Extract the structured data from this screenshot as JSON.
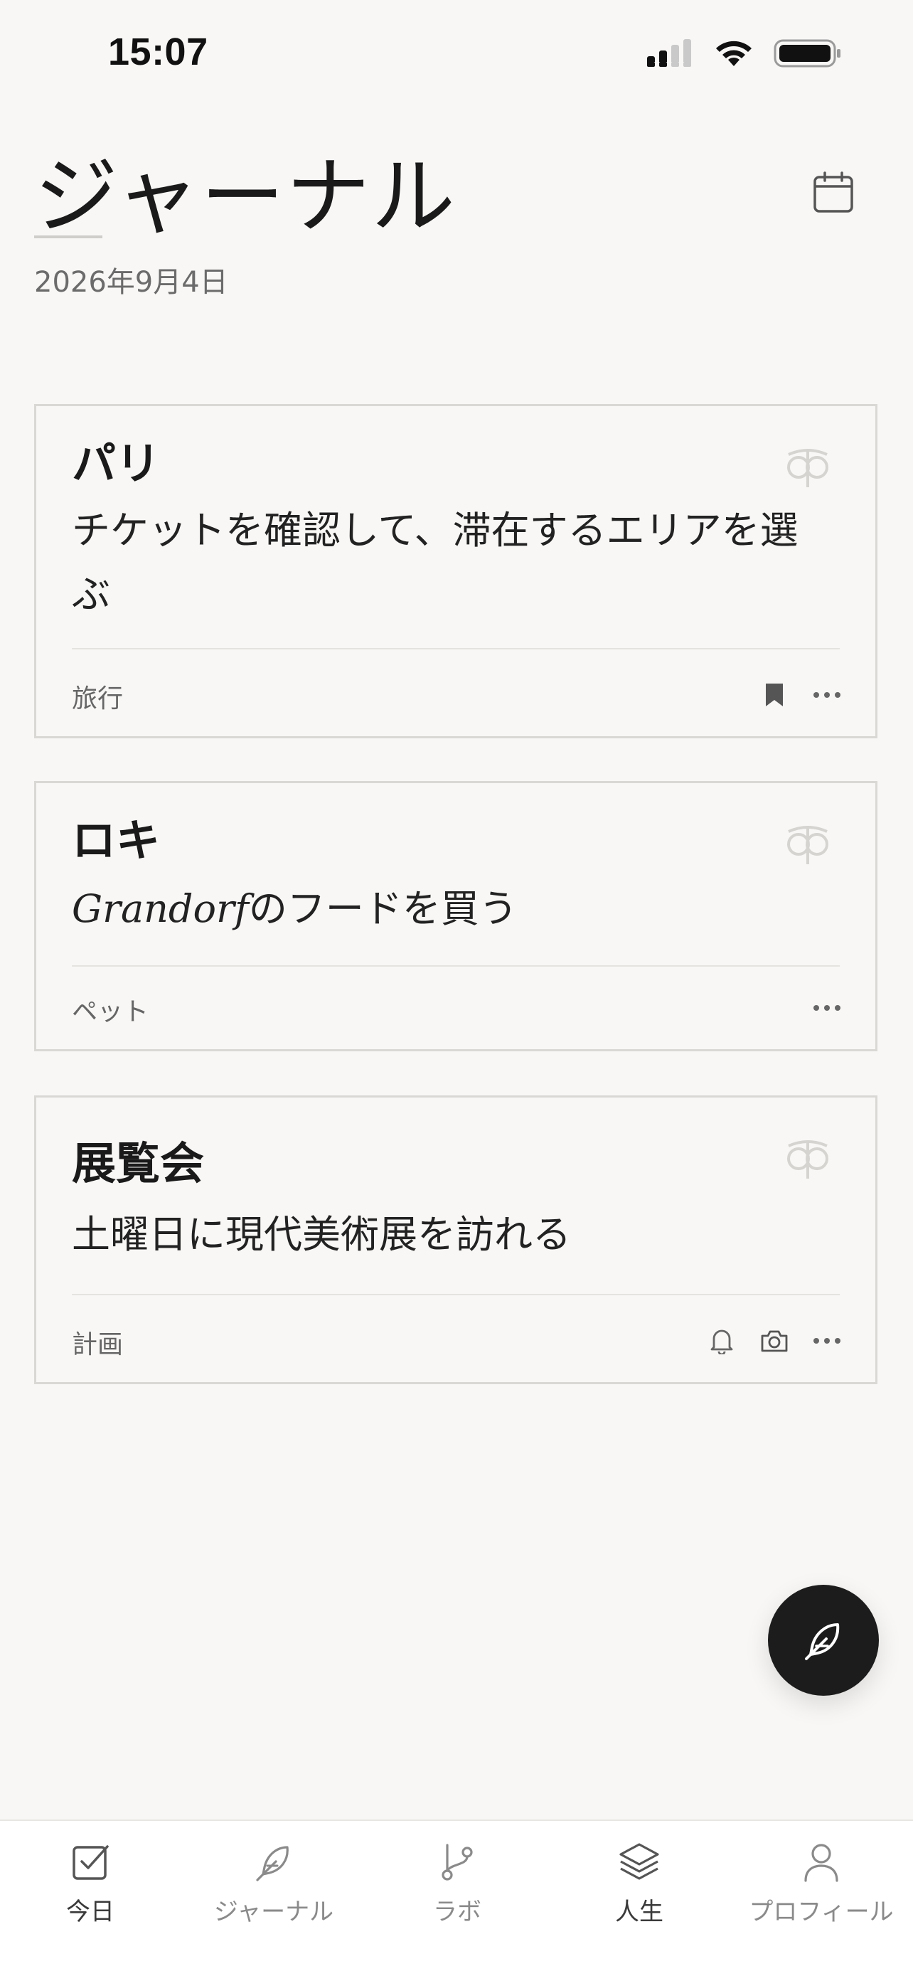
{
  "status_bar": {
    "time": "15:07",
    "icons": [
      "cellular-signal-icon",
      "wifi-icon",
      "battery-icon"
    ]
  },
  "header": {
    "title": "ジャーナル",
    "date": "2026年9月4日",
    "calendar_icon": "calendar-icon"
  },
  "cards": [
    {
      "title": "パリ",
      "body": "チケットを確認して、滞在するエリアを選ぶ",
      "tag": "旅行",
      "actions": [
        "bookmark-icon",
        "more-icon"
      ]
    },
    {
      "title": "ロキ",
      "body_italic": "Grandorf",
      "body_rest": "のフードを買う",
      "tag": "ペット",
      "actions": [
        "more-icon"
      ]
    },
    {
      "title": "展覧会",
      "body": "土曜日に現代美術展を訪れる",
      "tag": "計画",
      "actions": [
        "bell-icon",
        "camera-icon",
        "more-icon"
      ]
    }
  ],
  "fab": {
    "icon": "feather-pen-icon"
  },
  "tab_bar": {
    "tabs": [
      {
        "label": "今日",
        "icon": "checkbox-icon",
        "active": true
      },
      {
        "label": "ジャーナル",
        "icon": "feather-icon",
        "active": false
      },
      {
        "label": "ラボ",
        "icon": "branch-icon",
        "active": false
      },
      {
        "label": "人生",
        "icon": "layers-icon",
        "active": true
      },
      {
        "label": "プロフィール",
        "icon": "person-icon",
        "active": false
      }
    ]
  },
  "colors": {
    "background": "#f8f7f5",
    "card_border": "#d9d8d5",
    "fab": "#1c1c1c",
    "text": "#1a1a1a",
    "muted": "#6b6b6b"
  }
}
